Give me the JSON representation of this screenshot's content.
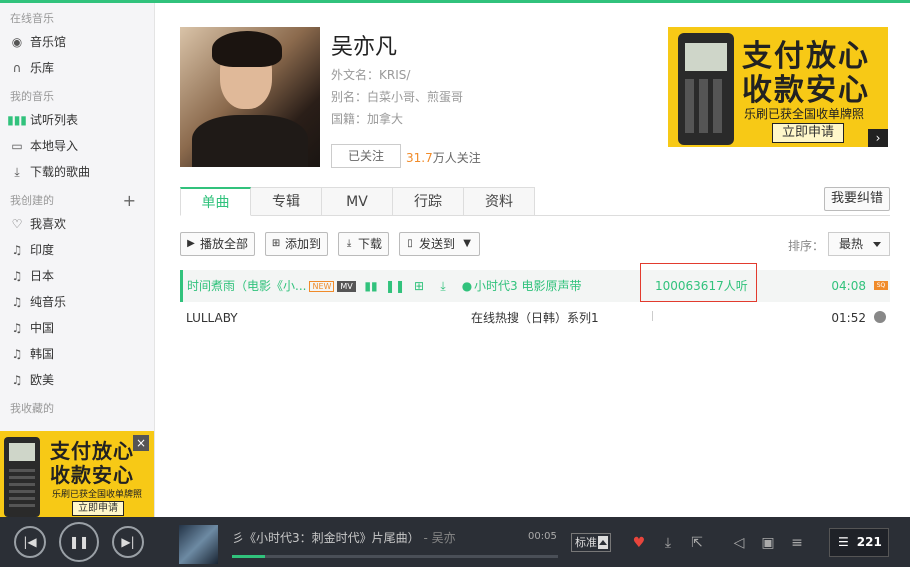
{
  "sidebar": {
    "section_online": "在线音乐",
    "online_items": [
      {
        "label": "音乐馆",
        "icon": "disc-icon"
      },
      {
        "label": "乐库",
        "icon": "headphones-icon"
      }
    ],
    "section_my": "我的音乐",
    "my_items": [
      {
        "label": "试听列表",
        "icon": "bars-icon"
      },
      {
        "label": "本地导入",
        "icon": "monitor-icon"
      },
      {
        "label": "下载的歌曲",
        "icon": "download-icon"
      }
    ],
    "section_created": "我创建的",
    "created_add": "+",
    "created_items": [
      {
        "label": "我喜欢",
        "icon": "heart-icon"
      },
      {
        "label": "印度",
        "icon": "note-icon"
      },
      {
        "label": "日本",
        "icon": "note-icon"
      },
      {
        "label": "纯音乐",
        "icon": "note-icon"
      },
      {
        "label": "中国",
        "icon": "note-icon"
      },
      {
        "label": "韩国",
        "icon": "note-icon"
      },
      {
        "label": "欧美",
        "icon": "note-icon"
      }
    ],
    "section_collected": "我收藏的",
    "ad": {
      "line1": "支付放心",
      "line2": "收款安心",
      "line3": "乐刷已获全国收单牌照",
      "button": "立即申请",
      "close": "×"
    }
  },
  "artist": {
    "name": "吴亦凡",
    "foreign_name": "外文名：KRIS/",
    "alias": "别名：白菜小哥、煎蛋哥",
    "nationality": "国籍：加拿大",
    "follow_label": "已关注",
    "follow_count": "31.7",
    "follow_suffix": "万人关注"
  },
  "ad_banner": {
    "line1": "支付放心",
    "line2": "收款安心",
    "line3": "乐刷已获全国收单牌照",
    "button": "立即申请",
    "arrow": "›"
  },
  "tabs": [
    "单曲",
    "专辑",
    "MV",
    "行踪",
    "资料"
  ],
  "report_button": "我要纠错",
  "toolbar": {
    "play_all": "播放全部",
    "add_to": "添加到",
    "download": "下载",
    "send_to": "发送到"
  },
  "sort": {
    "label": "排序：",
    "value": "最热"
  },
  "songs": [
    {
      "title": "时间煮雨（电影《小...",
      "tag_new": "NEW",
      "tag_mv": "MV",
      "album": "小时代3 电影原声带",
      "plays": "100063617人听",
      "duration": "04:08",
      "quality": "SQ"
    },
    {
      "title": "LULLABY",
      "album": "在线热搜（日韩）系列1",
      "plays": "",
      "duration": "01:52"
    }
  ],
  "player": {
    "now_playing": "彡《小时代3：刺金时代》片尾曲）",
    "separator": " - ",
    "artist": "吴亦",
    "elapsed": "00:05",
    "progress_fraction": 0.1,
    "quality": "标准",
    "playlist_count": "221"
  },
  "colors": {
    "accent": "#31c27c",
    "highlight_box": "#e23b2e",
    "player_bg": "#2b2f36",
    "ad_yellow": "#f7c916"
  }
}
